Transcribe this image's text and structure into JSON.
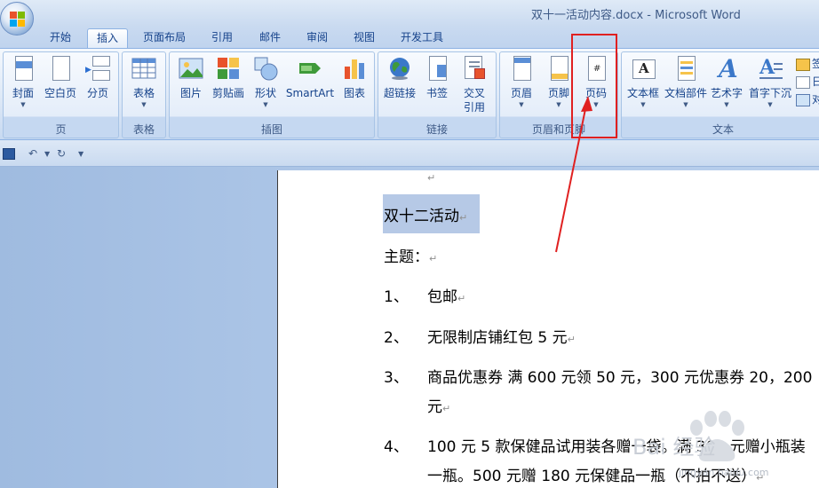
{
  "window": {
    "title": "双十一活动内容.docx - Microsoft Word"
  },
  "tabs": [
    {
      "label": "开始"
    },
    {
      "label": "插入"
    },
    {
      "label": "页面布局"
    },
    {
      "label": "引用"
    },
    {
      "label": "邮件"
    },
    {
      "label": "审阅"
    },
    {
      "label": "视图"
    },
    {
      "label": "开发工具"
    }
  ],
  "ribbon": {
    "groups": {
      "pages": {
        "label": "页",
        "buttons": [
          "封面",
          "空白页",
          "分页"
        ]
      },
      "tables": {
        "label": "表格",
        "buttons": [
          "表格"
        ]
      },
      "illustrations": {
        "label": "插图",
        "buttons": [
          "图片",
          "剪贴画",
          "形状",
          "SmartArt",
          "图表"
        ]
      },
      "links": {
        "label": "链接",
        "buttons": [
          "超链接",
          "书签",
          "交叉",
          "引用"
        ]
      },
      "header_footer": {
        "label": "页眉和页脚",
        "buttons": [
          "页眉",
          "页脚",
          "页码"
        ]
      },
      "text": {
        "label": "文本",
        "buttons": [
          "文本框",
          "文档部件",
          "艺术字",
          "首字下沉"
        ],
        "small": [
          "签",
          "日",
          "对"
        ]
      }
    }
  },
  "document": {
    "heading": "双十二活动",
    "subject": "主题：",
    "items": [
      {
        "num": "1、",
        "text": "包邮"
      },
      {
        "num": "2、",
        "text": "无限制店铺红包 5 元"
      },
      {
        "num": "3、",
        "text": "商品优惠券 满 600 元领 50 元，300 元优惠券 20，200",
        "cont": "元"
      },
      {
        "num": "4、",
        "text": "100 元 5 款保健品试用装各赠一袋。满 300 元赠小瓶装",
        "cont": "一瓶。500 元赠 180 元保健品一瓶（不拍不送）"
      }
    ]
  },
  "watermark": {
    "text": "Bai 经验",
    "url": "jingyan.baidu.com"
  },
  "colors": {
    "annotation": "#e02020",
    "ribbon": "#dbe7f6",
    "accent": "#15428b"
  }
}
